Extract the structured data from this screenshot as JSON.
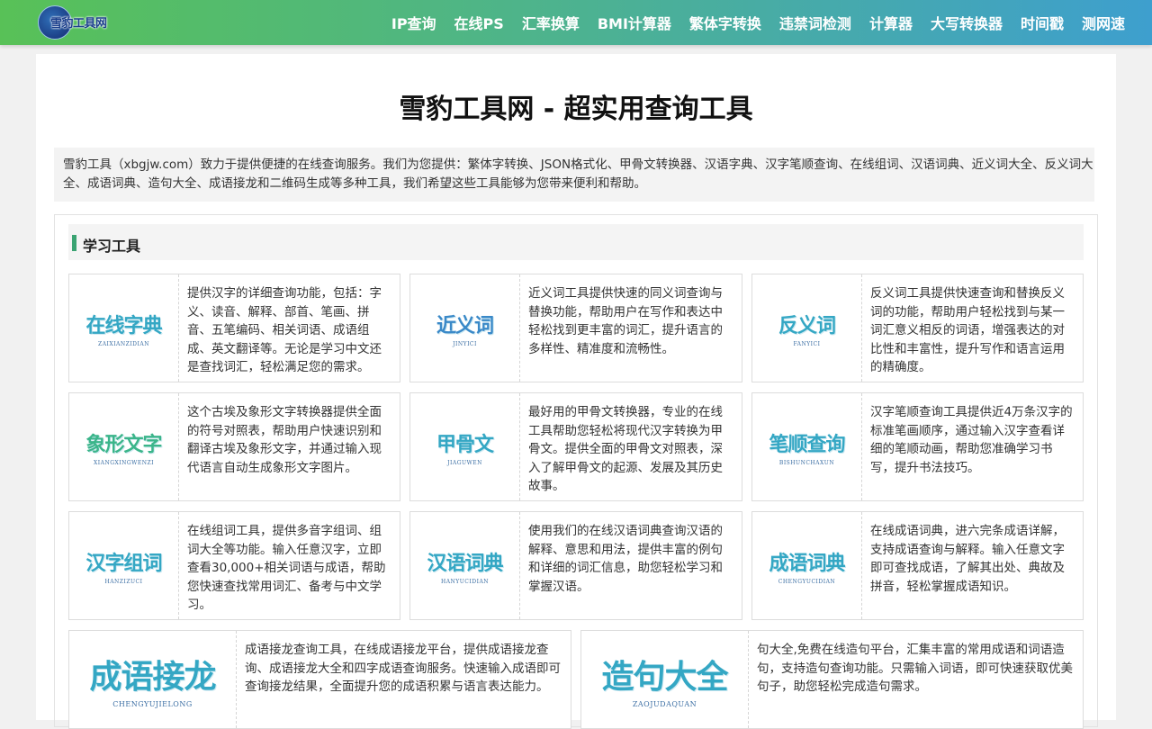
{
  "logo": {
    "text": "雪豹工具网"
  },
  "nav": [
    "IP查询",
    "在线PS",
    "汇率换算",
    "BMI计算器",
    "繁体字转换",
    "违禁词检测",
    "计算器",
    "大写转换器",
    "时间戳",
    "测网速"
  ],
  "page": {
    "title": "雪豹工具网 - 超实用查询工具",
    "intro": "雪豹工具（xbgjw.com）致力于提供便捷的在线查询服务。我们为您提供：繁体字转换、JSON格式化、甲骨文转换器、汉语字典、汉字笔顺查询、在线组词、汉语词典、近义词大全、反义词大全、成语词典、造句大全、成语接龙和二维码生成等多种工具，我们希望这些工具能够为您带来便利和帮助。"
  },
  "section": {
    "title": "学习工具"
  },
  "cards": [
    {
      "logo_text": "在线字典",
      "logo_sub": "ZAIXIANZIDIAN",
      "desc": "提供汉字的详细查询功能，包括：字义、读音、解释、部首、笔画、拼音、五笔编码、相关词语、成语组成、英文翻译等。无论是学习中文还是查找词汇，轻松满足您的需求。"
    },
    {
      "logo_text": "近义词",
      "logo_sub": "JINYICI",
      "desc": "近义词工具提供快速的同义词查询与替换功能，帮助用户在写作和表达中轻松找到更丰富的词汇，提升语言的多样性、精准度和流畅性。"
    },
    {
      "logo_text": "反义词",
      "logo_sub": "FANYICI",
      "desc": "反义词工具提供快速查询和替换反义词的功能，帮助用户轻松找到与某一词汇意义相反的词语，增强表达的对比性和丰富性，提升写作和语言运用的精确度。"
    },
    {
      "logo_text": "象形文字",
      "logo_sub": "XIANGXINGWENZI",
      "desc": "这个古埃及象形文字转换器提供全面的符号对照表，帮助用户快速识别和翻译古埃及象形文字，并通过输入现代语言自动生成象形文字图片。"
    },
    {
      "logo_text": "甲骨文",
      "logo_sub": "JIAGUWEN",
      "desc": "最好用的甲骨文转换器，专业的在线工具帮助您轻松将现代汉字转换为甲骨文。提供全面的甲骨文对照表，深入了解甲骨文的起源、发展及其历史故事。"
    },
    {
      "logo_text": "笔顺查询",
      "logo_sub": "BISHUNCHAXUN",
      "desc": "汉字笔顺查询工具提供近4万条汉字的标准笔画顺序，通过输入汉字查看详细的笔顺动画，帮助您准确学习书写，提升书法技巧。"
    },
    {
      "logo_text": "汉字组词",
      "logo_sub": "HANZIZUCI",
      "desc": "在线组词工具，提供多音字组词、组词大全等功能。输入任意汉字，立即查看30,000+相关词语与成语，帮助您快速查找常用词汇、备考与中文学习。"
    },
    {
      "logo_text": "汉语词典",
      "logo_sub": "HANYUCIDIAN",
      "desc": "使用我们的在线汉语词典查询汉语的解释、意思和用法，提供丰富的例句和详细的词汇信息，助您轻松学习和掌握汉语。"
    },
    {
      "logo_text": "成语词典",
      "logo_sub": "CHENGYUCIDIAN",
      "desc": "在线成语词典，进六完条成语详解，支持成语查询与解释。输入任意文字即可查找成语，了解其出处、典故及拼音，轻松掌握成语知识。"
    },
    {
      "logo_text": "成语接龙",
      "logo_sub": "CHENGYUJIELONG",
      "desc": "成语接龙查询工具，在线成语接龙平台，提供成语接龙查询、成语接龙大全和四字成语查询服务。快速输入成语即可查询接龙结果，全面提升您的成语积累与语言表达能力。"
    },
    {
      "logo_text": "造句大全",
      "logo_sub": "ZAOJUDAQUAN",
      "desc": "句大全,免费在线造句平台，汇集丰富的常用成语和词语造句，支持造句查询功能。只需输入词语，即可快速获取优美句子，助您轻松完成造句需求。"
    }
  ]
}
